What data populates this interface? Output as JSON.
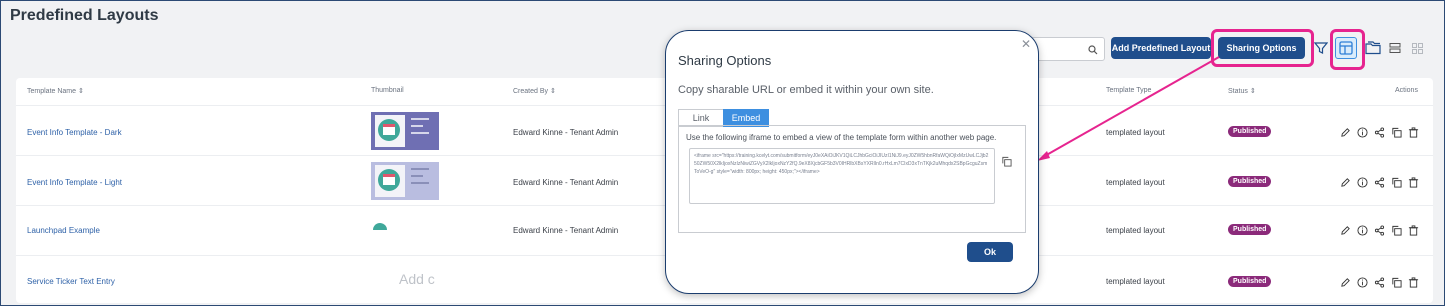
{
  "page": {
    "title": "Predefined Layouts"
  },
  "toolbar": {
    "add_label": "Add Predefined Layout",
    "sharing_label": "Sharing Options"
  },
  "table": {
    "headers": [
      "Template Name",
      "Thumbnail",
      "Created By",
      "Template Type",
      "Status",
      "Actions"
    ],
    "rows": [
      {
        "name": "Event Info Template - Dark",
        "created_by": "Edward Kinne - Tenant Admin",
        "type": "templated layout",
        "status": "Published"
      },
      {
        "name": "Event Info Template - Light",
        "created_by": "Edward Kinne - Tenant Admin",
        "type": "templated layout",
        "status": "Published"
      },
      {
        "name": "Launchpad Example",
        "created_by": "Edward Kinne - Tenant Admin",
        "type": "templated layout",
        "status": "Published"
      },
      {
        "name": "Service Ticker Text Entry",
        "created_by": "",
        "type": "templated layout",
        "status": "Published"
      }
    ],
    "add_placeholder": "Add c"
  },
  "modal": {
    "title": "Sharing Options",
    "subtitle": "Copy sharable URL or embed it within your own site.",
    "tab_link": "Link",
    "tab_embed": "Embed",
    "description": "Use the following iframe to embed a view of the template form within another web page.",
    "iframe_code": "<iframe src=\"https://training.kcelyt.com/submitform/eyJ0eXAiOiJKV1QiLCJhbGciOiJIUzI1NiJ9.eyJ0ZW5hbnRfaWQiOjIxMzUwLCJjb250ZW50X2lkIjoxNzIzNiwiZGVyX2lkIjoxNzY2fQ.9eX8XjcbGF5b3V0IHRlbXBsYXRlIn0.rHxLm7CIxD3xTnTKjk2uMhqdx2SBpGcguZsmToVeO-g\" style=\"width: 800px; height: 450px;\"></iframe>",
    "ok_label": "Ok"
  },
  "colors": {
    "brand": "#1f4e8c",
    "highlight": "#e6248f",
    "badge": "#8b2a7a"
  }
}
